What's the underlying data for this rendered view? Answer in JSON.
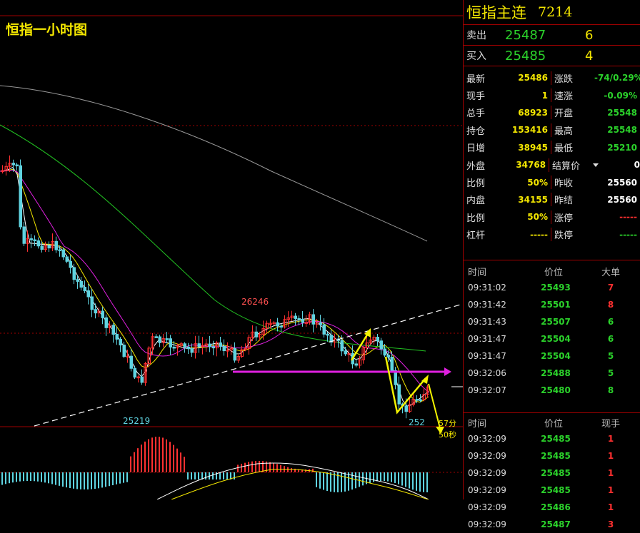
{
  "chart_title": "恒指一小时图",
  "instrument": {
    "name": "恒指主连",
    "code": "7214"
  },
  "quote": {
    "sell": {
      "label": "卖出",
      "price": "25487",
      "volume": "6"
    },
    "buy": {
      "label": "买入",
      "price": "25485",
      "volume": "4"
    }
  },
  "stats": [
    {
      "k": "最新",
      "v": "25486",
      "vc": "g",
      "k2": "涨跌",
      "v2": "-74/0.29%",
      "v2c": "g"
    },
    {
      "k": "现手",
      "v": "1",
      "vc": "y",
      "k2": "速涨",
      "v2": "-0.09%",
      "v2c": "g"
    },
    {
      "k": "总手",
      "v": "68923",
      "vc": "y",
      "k2": "开盘",
      "v2": "25548",
      "v2c": "g"
    },
    {
      "k": "持仓",
      "v": "153416",
      "vc": "y",
      "k2": "最高",
      "v2": "25548",
      "v2c": "g"
    },
    {
      "k": "日增",
      "v": "38945",
      "vc": "y",
      "k2": "最低",
      "v2": "25210",
      "v2c": "g"
    },
    {
      "k": "外盘",
      "v": "34768",
      "vc": "y",
      "k2": "结算价",
      "v2": "0",
      "v2c": "w"
    },
    {
      "k": "比例",
      "v": "50%",
      "vc": "y",
      "k2": "昨收",
      "v2": "25560",
      "v2c": "w"
    },
    {
      "k": "内盘",
      "v": "34155",
      "vc": "y",
      "k2": "昨结",
      "v2": "25560",
      "v2c": "w"
    },
    {
      "k": "比例",
      "v": "50%",
      "vc": "y",
      "k2": "涨停",
      "v2": "-----",
      "v2c": "r"
    },
    {
      "k": "杠杆",
      "v": "-----",
      "vc": "y",
      "k2": "跌停",
      "v2": "-----",
      "v2c": "g"
    }
  ],
  "big_orders": {
    "headers": [
      "时间",
      "价位",
      "大单"
    ],
    "rows": [
      {
        "t": "09:31:02",
        "p": "25493",
        "q": "7",
        "qc": "r"
      },
      {
        "t": "09:31:42",
        "p": "25501",
        "q": "8",
        "qc": "r"
      },
      {
        "t": "09:31:43",
        "p": "25507",
        "q": "6",
        "qc": "g"
      },
      {
        "t": "09:31:47",
        "p": "25504",
        "q": "6",
        "qc": "g"
      },
      {
        "t": "09:31:47",
        "p": "25504",
        "q": "5",
        "qc": "g"
      },
      {
        "t": "09:32:06",
        "p": "25488",
        "q": "5",
        "qc": "g"
      },
      {
        "t": "09:32:07",
        "p": "25480",
        "q": "8",
        "qc": "g"
      }
    ]
  },
  "ticks": {
    "headers": [
      "时间",
      "价位",
      "现手"
    ],
    "rows": [
      {
        "t": "09:32:09",
        "p": "25485",
        "q": "1",
        "qc": "r"
      },
      {
        "t": "09:32:09",
        "p": "25485",
        "q": "1",
        "qc": "r"
      },
      {
        "t": "09:32:09",
        "p": "25485",
        "q": "1",
        "qc": "r"
      },
      {
        "t": "09:32:09",
        "p": "25485",
        "q": "1",
        "qc": "r"
      },
      {
        "t": "09:32:09",
        "p": "25486",
        "q": "1",
        "qc": "r"
      },
      {
        "t": "09:32:09",
        "p": "25487",
        "q": "3",
        "qc": "r"
      }
    ]
  },
  "annotations": {
    "high": "26246",
    "low": "25219",
    "last": "252",
    "countdown": "57分50秒"
  },
  "colors": {
    "up": "#ff3030",
    "down": "#5fd3e0",
    "ma_fast": "#ffffff",
    "ma_mid": "#f3e600",
    "ma_slow": "#e020e0",
    "ma_long": "#22c022",
    "ma_longest": "#9a9a9a",
    "grid": "#a00000",
    "arrow": "#f3f300",
    "support": "#e020e0"
  }
}
